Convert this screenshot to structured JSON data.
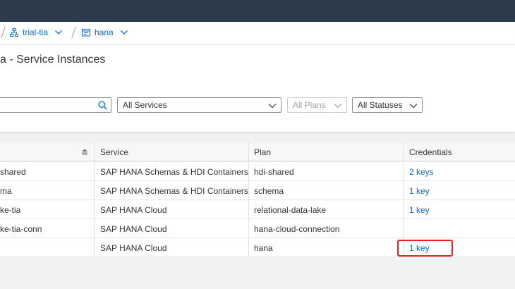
{
  "breadcrumb": {
    "space": "trial-tia",
    "instance": "hana"
  },
  "page": {
    "title": "a - Service Instances"
  },
  "filters": {
    "search_placeholder": "",
    "services": "All Services",
    "plans": "All Plans",
    "statuses": "All Statuses"
  },
  "table": {
    "headers": {
      "name": "",
      "service": "Service",
      "plan": "Plan",
      "credentials": "Credentials"
    },
    "rows": [
      {
        "name": "shared",
        "service": "SAP HANA Schemas & HDI Containers",
        "plan": "hdi-shared",
        "credentials": "2 keys"
      },
      {
        "name": "ma",
        "service": "SAP HANA Schemas & HDI Containers",
        "plan": "schema",
        "credentials": "1 key"
      },
      {
        "name": "ke-tia",
        "service": "SAP HANA Cloud",
        "plan": "relational-data-lake",
        "credentials": "1 key"
      },
      {
        "name": "ke-tia-conn",
        "service": "SAP HANA Cloud",
        "plan": "hana-cloud-connection",
        "credentials": ""
      },
      {
        "name": "",
        "service": "SAP HANA Cloud",
        "plan": "hana",
        "credentials": "1 key"
      }
    ]
  },
  "colors": {
    "shellbar": "#2c3a4c",
    "link": "#0a6ed1",
    "highlight": "#e5231f"
  }
}
